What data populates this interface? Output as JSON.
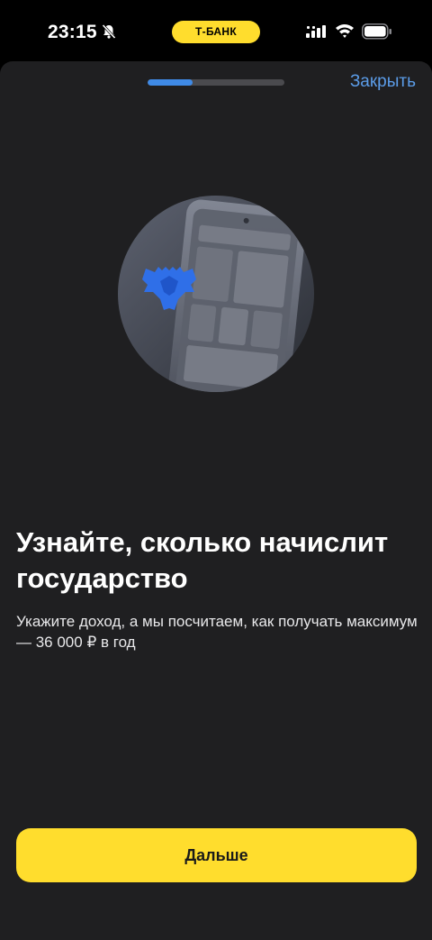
{
  "status_bar": {
    "time": "23:15",
    "bank_label": "Т-БАНК",
    "icons": [
      "bell-muted-icon",
      "signal-icon",
      "wifi-icon",
      "battery-icon"
    ]
  },
  "header": {
    "close_label": "Закрыть",
    "progress_fraction": 0.33
  },
  "illustration": {
    "icons": [
      "phone-icon",
      "eagle-emblem-icon"
    ]
  },
  "main": {
    "title": "Узнайте, сколько начислит государство",
    "subtitle": "Укажите доход, а мы посчитаем, как получать максимум — 36 000 ₽ в год"
  },
  "footer": {
    "next_label": "Дальше"
  },
  "colors": {
    "accent_yellow": "#ffdd2d",
    "link_blue": "#5b9ce8",
    "progress_blue": "#3f8ae6",
    "sheet_bg": "#1f1f21"
  }
}
